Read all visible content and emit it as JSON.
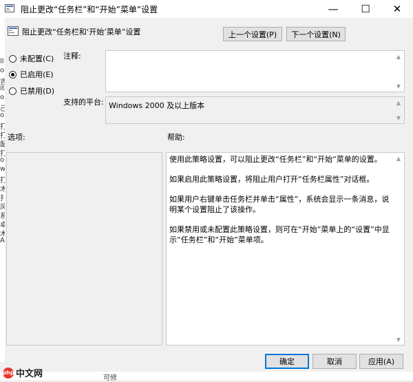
{
  "window": {
    "title": "阻止更改“任务栏”和“开始”菜单”设置",
    "minimize": "—",
    "maximize": "☐",
    "close": "✕"
  },
  "header": {
    "setting_name": "阻止更改“任务栏和‘开始’菜单”设置",
    "prev_button": "上一个设置(P)",
    "next_button": "下一个设置(N)"
  },
  "state": {
    "options": [
      {
        "label": "未配置(C)",
        "selected": false
      },
      {
        "label": "已启用(E)",
        "selected": true
      },
      {
        "label": "已禁用(D)",
        "selected": false
      }
    ]
  },
  "comment": {
    "label": "注释:",
    "value": ""
  },
  "platform": {
    "label": "支持的平台:",
    "value": "Windows 2000 及以上版本"
  },
  "options_section": {
    "label": "选项:"
  },
  "help_section": {
    "label": "帮助:",
    "paragraphs": [
      "使用此策略设置，可以阻止更改“任务栏”和“开始”菜单的设置。",
      "如果启用此策略设置，将阻止用户打开“任务栏属性”对话框。",
      "如果用户右键单击任务栏并单击“属性”，系统会显示一条消息，说明某个设置阻止了该操作。",
      "如果禁用或未配置此策略设置，则可在“开始”菜单上的“设置”中显示“任务栏”和“开始”菜单项。"
    ]
  },
  "footer": {
    "ok": "确定",
    "cancel": "取消",
    "apply": "应用(A)"
  },
  "bottom_strip": {
    "text": "可修",
    "logo_mark": "php",
    "logo_text": "中文网"
  },
  "left_strip_chars": [
    "ll",
    "ol",
    "吉",
    "it",
    "ol",
    "己",
    "ol",
    "打",
    "打",
    "配",
    "打",
    "ol",
    "w",
    "打",
    "木",
    "扌",
    "风",
    "系",
    "卓",
    "木",
    "A"
  ]
}
